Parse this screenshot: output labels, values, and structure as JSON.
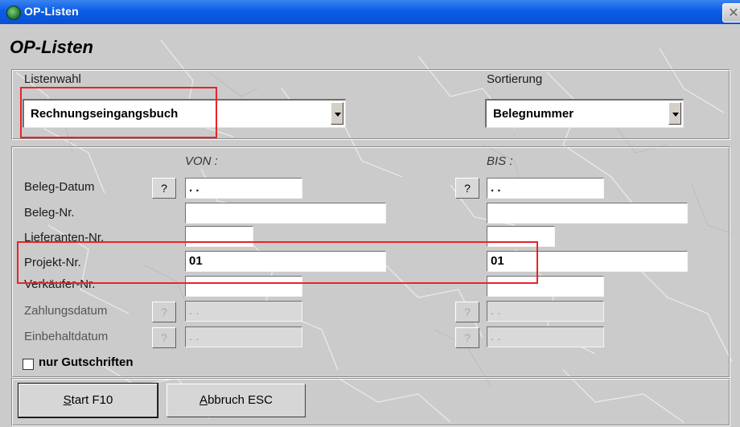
{
  "window": {
    "title": "OP-Listen",
    "close_glyph": "✕",
    "icon": "app-globe-icon"
  },
  "heading": "OP-Listen",
  "listenwahl": {
    "label": "Listenwahl",
    "value": "Rechnungseingangsbuch"
  },
  "sortierung": {
    "label": "Sortierung",
    "value": "Belegnummer"
  },
  "range": {
    "von_label": "VON :",
    "bis_label": "BIS :",
    "rows": [
      {
        "label": "Beleg-Datum",
        "von": ". .",
        "bis": ". .",
        "help": "?"
      },
      {
        "label": "Beleg-Nr.",
        "von": "",
        "bis": ""
      },
      {
        "label": "Lieferanten-Nr.",
        "von": "",
        "bis": ""
      },
      {
        "label": "Projekt-Nr.",
        "von": "01",
        "bis": "01"
      },
      {
        "label": "Verkäufer-Nr.",
        "von": "",
        "bis": ""
      },
      {
        "label": "Zahlungsdatum",
        "von": ". .",
        "bis": ". .",
        "help": "?"
      },
      {
        "label": "Einbehaltdatum",
        "von": ". .",
        "bis": ". .",
        "help": "?"
      }
    ]
  },
  "gutschriften": {
    "label": "nur Gutschriften",
    "checked": false
  },
  "buttons": {
    "start": {
      "key": "S",
      "rest": "tart F10"
    },
    "abbruch": {
      "key": "A",
      "rest": "bbruch ESC"
    }
  },
  "colors": {
    "highlight": "#e8232a",
    "titlebar": "#0a5ee6"
  }
}
